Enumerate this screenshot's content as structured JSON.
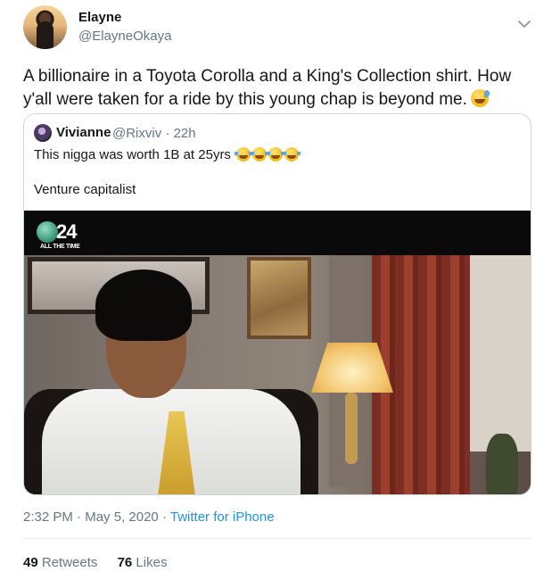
{
  "author": {
    "display_name": "Elayne",
    "handle": "@ElayneOkaya"
  },
  "tweet": {
    "text": "A billionaire in a Toyota Corolla and a King's Collection shirt. How y'all were taken for a ride by this young chap is beyond me.",
    "emoji": "sweat-smile-emoji"
  },
  "quoted": {
    "display_name": "Vivianne",
    "handle": "@Rixviv",
    "separator": "·",
    "time": "22h",
    "text_line1": "This nigga was worth 1B at 25yrs",
    "text_line2": "Venture capitalist",
    "media": {
      "channel_number": "24",
      "channel_tagline": "ALL THE TIME"
    }
  },
  "footer": {
    "time": "2:32 PM",
    "dot1": "·",
    "date": "May 5, 2020",
    "dot2": "·",
    "source": "Twitter for iPhone",
    "retweets_count": "49",
    "retweets_label": "Retweets",
    "likes_count": "76",
    "likes_label": "Likes"
  },
  "icons": {
    "menu": "chevron-down-icon"
  },
  "colors": {
    "text": "#14171a",
    "secondary": "#657786",
    "link": "#1b95e0",
    "border": "#ccd6dd"
  }
}
